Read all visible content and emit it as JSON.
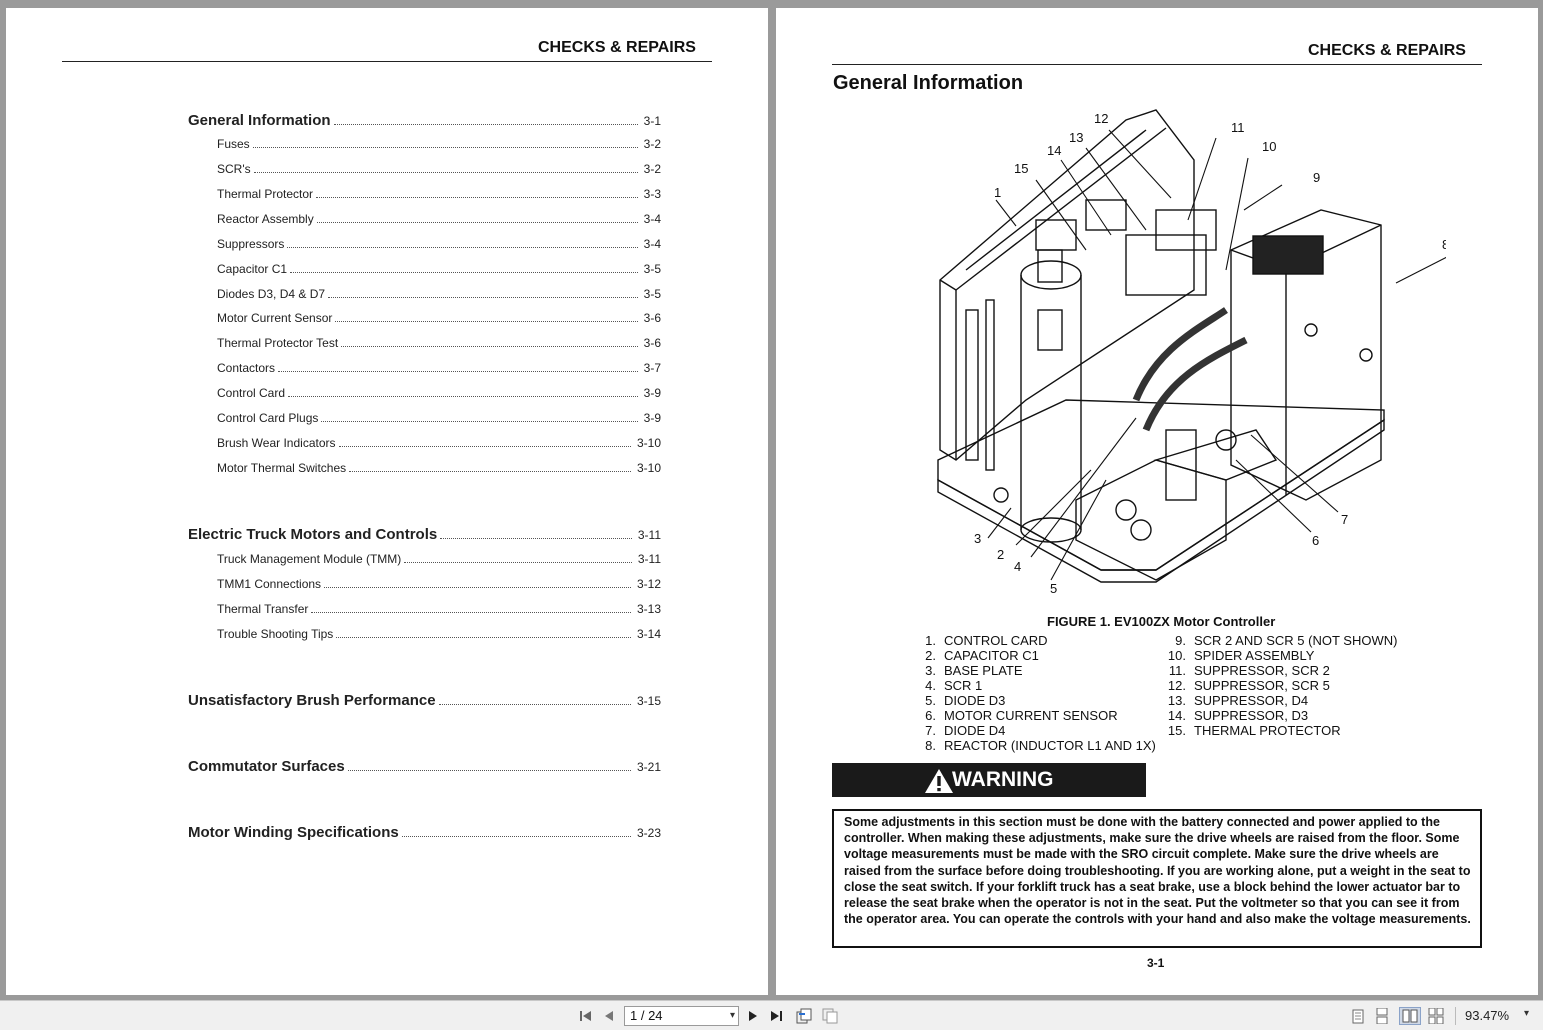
{
  "left_page": {
    "header": "CHECKS & REPAIRS",
    "toc": [
      {
        "label": "General Information",
        "page": "3-1",
        "level": "major"
      },
      {
        "label": "Fuses",
        "page": "3-2",
        "level": "minor"
      },
      {
        "label": "SCR's",
        "page": "3-2",
        "level": "minor"
      },
      {
        "label": "Thermal Protector",
        "page": "3-3",
        "level": "minor"
      },
      {
        "label": "Reactor Assembly",
        "page": "3-4",
        "level": "minor"
      },
      {
        "label": "Suppressors",
        "page": "3-4",
        "level": "minor"
      },
      {
        "label": "Capacitor C1",
        "page": "3-5",
        "level": "minor"
      },
      {
        "label": "Diodes D3, D4 & D7",
        "page": "3-5",
        "level": "minor"
      },
      {
        "label": "Motor Current Sensor",
        "page": "3-6",
        "level": "minor"
      },
      {
        "label": "Thermal Protector Test",
        "page": "3-6",
        "level": "minor"
      },
      {
        "label": "Contactors",
        "page": "3-7",
        "level": "minor"
      },
      {
        "label": "Control Card",
        "page": "3-9",
        "level": "minor"
      },
      {
        "label": "Control Card Plugs",
        "page": "3-9",
        "level": "minor"
      },
      {
        "label": "Brush Wear Indicators",
        "page": "3-10",
        "level": "minor"
      },
      {
        "label": "Motor Thermal Switches",
        "page": "3-10",
        "level": "minor"
      },
      {
        "label": "Electric Truck Motors and Controls",
        "page": "3-11",
        "level": "major"
      },
      {
        "label": "Truck Management Module (TMM)",
        "page": "3-11",
        "level": "minor"
      },
      {
        "label": "TMM1 Connections",
        "page": "3-12",
        "level": "minor"
      },
      {
        "label": "Thermal Transfer",
        "page": "3-13",
        "level": "minor"
      },
      {
        "label": "Trouble Shooting Tips",
        "page": "3-14",
        "level": "minor"
      },
      {
        "label": "Unsatisfactory Brush Performance",
        "page": "3-15",
        "level": "major"
      },
      {
        "label": "Commutator Surfaces",
        "page": "3-21",
        "level": "major"
      },
      {
        "label": "Motor Winding Specifications",
        "page": "3-23",
        "level": "major"
      }
    ]
  },
  "right_page": {
    "header": "CHECKS & REPAIRS",
    "section_title": "General Information",
    "figure_callouts": [
      "1",
      "2",
      "3",
      "4",
      "5",
      "6",
      "7",
      "8",
      "9",
      "10",
      "11",
      "12",
      "13",
      "14",
      "15"
    ],
    "caption": "FIGURE 1.  EV100ZX Motor Controller",
    "legend_left": [
      {
        "num": "1.",
        "text": "CONTROL CARD"
      },
      {
        "num": "2.",
        "text": "CAPACITOR C1"
      },
      {
        "num": "3.",
        "text": "BASE PLATE"
      },
      {
        "num": "4.",
        "text": "SCR 1"
      },
      {
        "num": "5.",
        "text": "DIODE D3"
      },
      {
        "num": "6.",
        "text": "MOTOR CURRENT SENSOR"
      },
      {
        "num": "7.",
        "text": "DIODE D4"
      },
      {
        "num": "8.",
        "text": "REACTOR (INDUCTOR L1 AND 1X)"
      }
    ],
    "legend_right": [
      {
        "num": "9.",
        "text": "SCR 2 AND SCR 5 (NOT SHOWN)"
      },
      {
        "num": "10.",
        "text": "SPIDER ASSEMBLY"
      },
      {
        "num": "11.",
        "text": "SUPPRESSOR, SCR 2"
      },
      {
        "num": "12.",
        "text": "SUPPRESSOR, SCR 5"
      },
      {
        "num": "13.",
        "text": "SUPPRESSOR, D4"
      },
      {
        "num": "14.",
        "text": "SUPPRESSOR, D3"
      },
      {
        "num": "15.",
        "text": "THERMAL PROTECTOR"
      }
    ],
    "warning_label": "WARNING",
    "warning_text": "Some adjustments in this section must be done with the battery connected and power applied to the controller. When making these adjustments, make sure the drive wheels are raised from the floor. Some voltage measurements must be made with the SRO circuit complete. Make sure the drive wheels are raised from the surface before doing troubleshooting. If you are working alone, put a weight in the seat to close the seat switch. If your forklift truck has a seat brake, use a block behind the lower actuator bar to release the seat brake when the operator is not in the seat. Put the voltmeter so that you can see it from the operator area. You can operate the controls with your hand and also make the voltage measurements.",
    "page_number": "3-1"
  },
  "toolbar": {
    "page_field": "1 / 24",
    "zoom": "93.47%",
    "icons": [
      "first-page-icon",
      "previous-page-icon",
      "next-page-icon",
      "last-page-icon",
      "go-back-view-icon",
      "go-forward-view-icon",
      "single-page-icon",
      "continuous-page-icon",
      "two-page-icon",
      "two-page-continuous-icon",
      "zoom-dropdown-icon"
    ]
  }
}
